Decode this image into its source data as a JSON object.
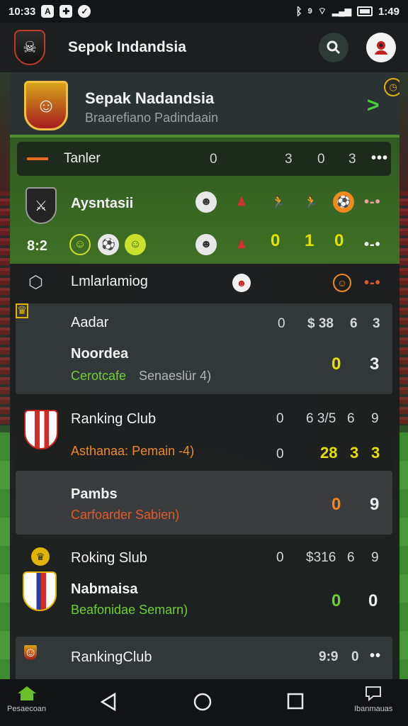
{
  "status_bar": {
    "time_left": "10:33",
    "time_right": "1:49",
    "icons_left": [
      "a-icon",
      "gamepad-icon",
      "v-icon"
    ],
    "icons_right": [
      "bluetooth-icon",
      "signal-icon",
      "wifi-icon",
      "battery-icon"
    ]
  },
  "app_bar": {
    "title": "Sepok Indandsia"
  },
  "featured": {
    "title": "Sepak Nadandsia",
    "subtitle": "Braarefiano Padindaain"
  },
  "live": {
    "tab_label": "Tanler",
    "tab_numbers": [
      "0",
      "3",
      "0",
      "3"
    ],
    "team": "Aysntasii",
    "score": "8:2",
    "scores": [
      "0",
      "1",
      "0"
    ]
  },
  "section": {
    "title": "Lmlarlamiog"
  },
  "match1": {
    "header": "Aadar",
    "header_num": "0",
    "header_stats": [
      "$ 38",
      "6",
      "3"
    ],
    "team": "Noordea",
    "detail": "Cerotcafe",
    "detail2": "Senaeslür 4)",
    "score_a": "0",
    "score_b": "3"
  },
  "match2": {
    "team": "Ranking Club",
    "num": "0",
    "stats": [
      "6 3/5",
      "6",
      "9"
    ],
    "detail": "Asthanaa: Pemain -4)",
    "num2": "0",
    "score": "28",
    "score2": "3",
    "score3": "3"
  },
  "match3": {
    "team": "Pambs",
    "detail": "Carfoarder Sabien)",
    "score_a": "0",
    "score_b": "9"
  },
  "match4": {
    "header": "Roking Slub",
    "num": "0",
    "stats": [
      "$316",
      "6",
      "9"
    ],
    "team": "Nabmaisa",
    "detail": "Beafonidae Semarn)",
    "score_a": "0",
    "score_b": "0"
  },
  "match5": {
    "team": "RankingClub",
    "score": "9:9",
    "num": "0"
  },
  "nav": {
    "home_label": "Pesaecoan",
    "chat_label": "Ibanmauas"
  },
  "colors": {
    "accent_green": "#4f8a2e",
    "score_yellow": "#e6e000",
    "score_green": "#6ed035",
    "score_orange": "#f08a1e",
    "detail_red": "#e35a2a"
  }
}
